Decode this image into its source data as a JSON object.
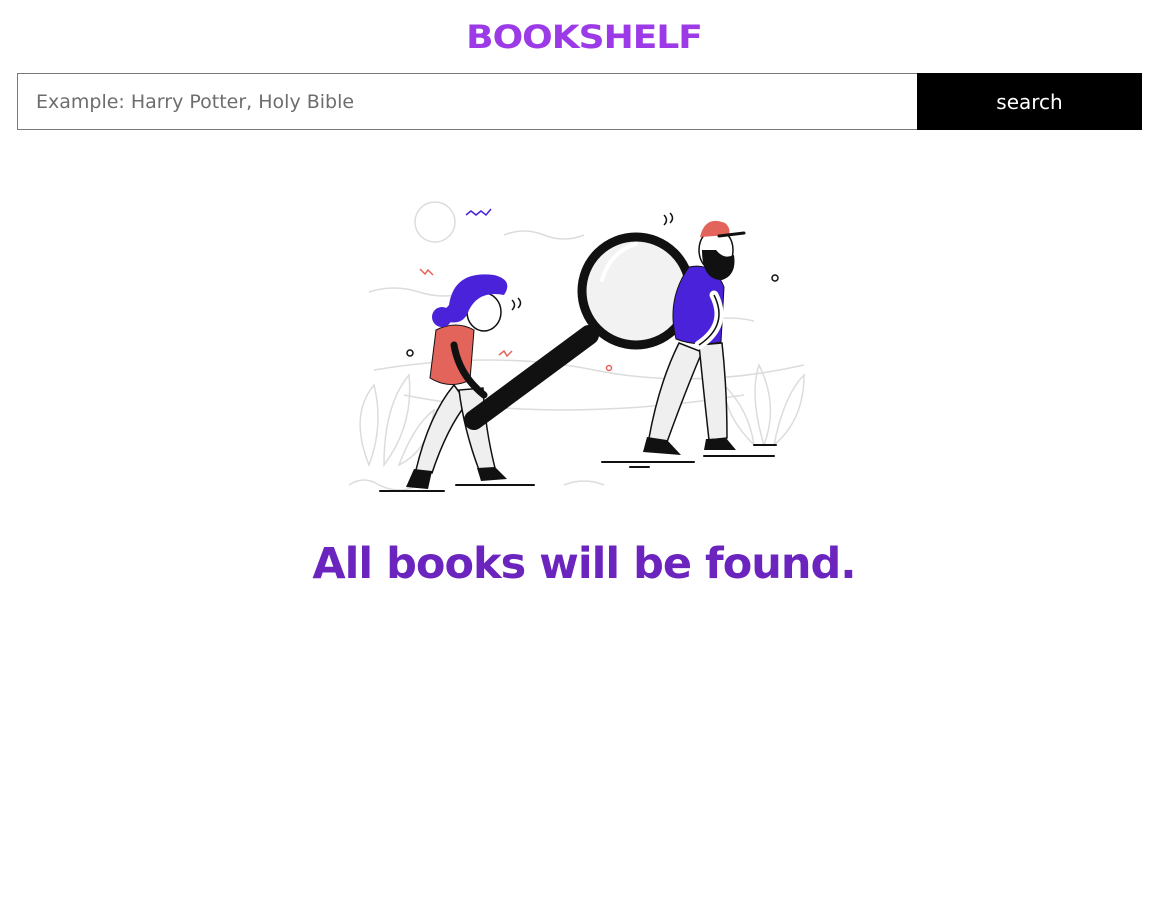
{
  "header": {
    "logo_text": "BOOKSHELF"
  },
  "search": {
    "placeholder": "Example: Harry Potter, Holy Bible",
    "value": "",
    "button_label": "search"
  },
  "hero": {
    "illustration_icon": "people-with-magnifying-glass-illustration",
    "tagline": "All books will be found."
  },
  "colors": {
    "brand_purple": "#9b3ae6",
    "tagline_purple": "#6c24bf",
    "button_black": "#000000",
    "figure_coral": "#e3645a",
    "figure_violet": "#4a22d9"
  }
}
